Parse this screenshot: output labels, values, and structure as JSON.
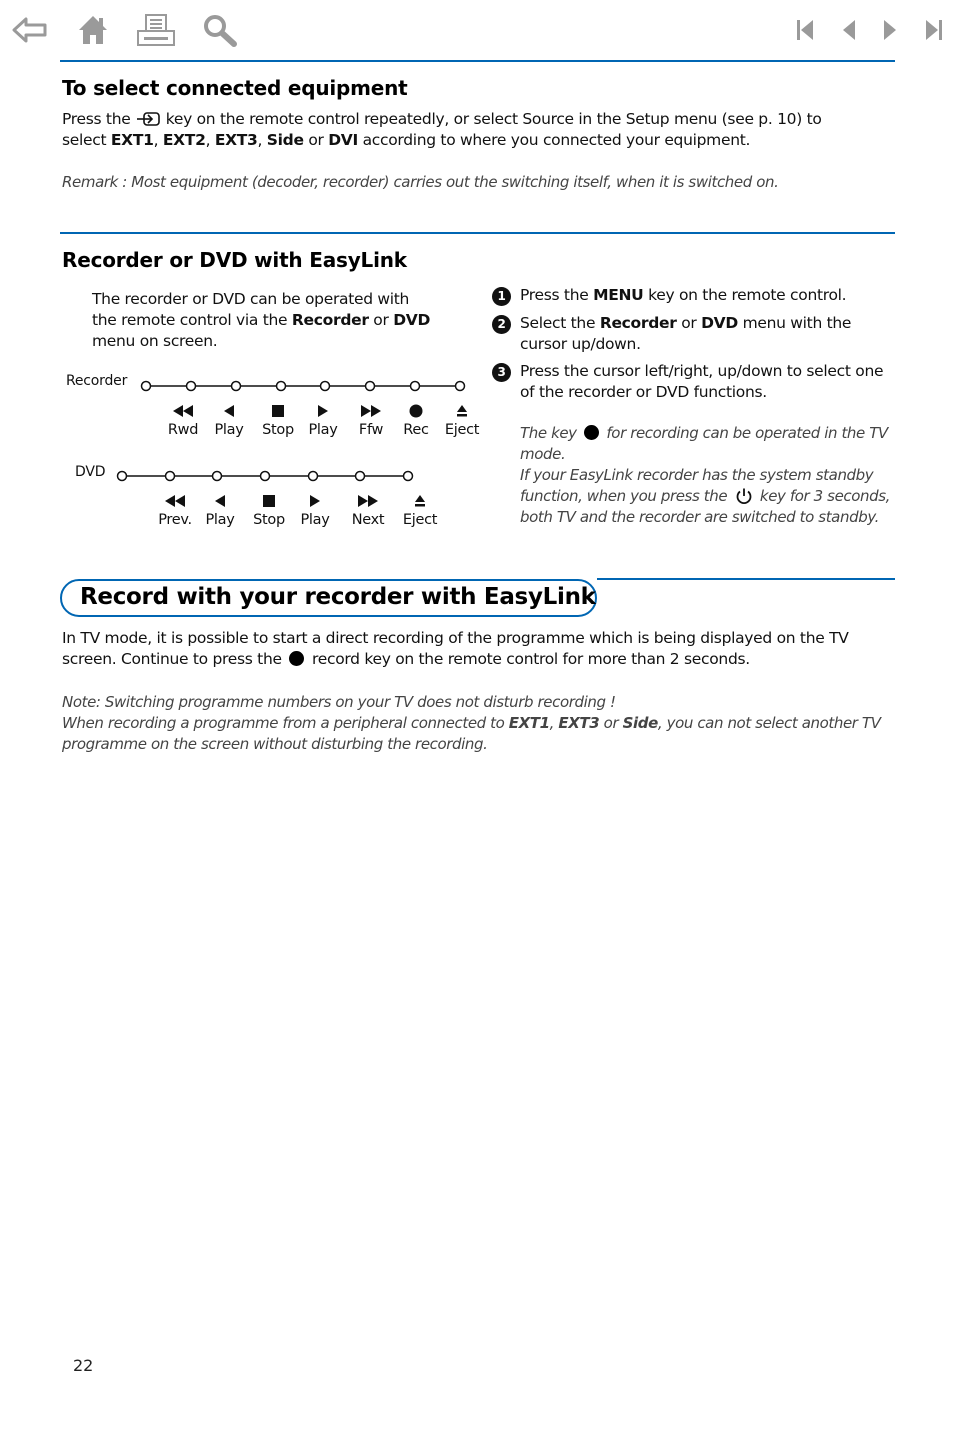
{
  "toolbar": {
    "left_icons": [
      "back-arrow-icon",
      "home-icon",
      "print-icon",
      "search-icon"
    ],
    "right_icons": [
      "first-page-icon",
      "previous-page-icon",
      "next-page-icon",
      "last-page-icon"
    ],
    "icon_color": "#9a9a9a"
  },
  "accent_color": "#0066b3",
  "section1": {
    "title": "To select connected equipment",
    "line1_a": "Press the",
    "line1_key_icon": "source-key-icon",
    "line1_b": "key on the remote control repeatedly, or select Source in the Setup menu (see p. 10) to",
    "line2_a": "select ",
    "line2_ext1": "EXT1",
    "line2_sep1": ", ",
    "line2_ext2": "EXT2",
    "line2_sep2": ", ",
    "line2_ext3": "EXT3",
    "line2_sep3": ", ",
    "line2_side": "Side",
    "line2_or": " or ",
    "line2_dvi": "DVI",
    "line2_b": " according to where you connected your equipment.",
    "remark": "Remark : Most equipment (decoder, recorder) carries out the switching itself, when it is switched on."
  },
  "section2": {
    "title": "Recorder or DVD with EasyLink",
    "intro_a": "The recorder or DVD can be operated with",
    "intro_b": "the remote control via the ",
    "intro_recorder": "Recorder",
    "intro_or": " or ",
    "intro_dvd": "DVD",
    "intro_c": "menu on screen.",
    "recorder_menu": {
      "label": "Recorder",
      "functions": [
        {
          "icon": "rewind-icon",
          "label": "Rwd"
        },
        {
          "icon": "play-reverse-icon",
          "label": "Play"
        },
        {
          "icon": "stop-icon",
          "label": "Stop"
        },
        {
          "icon": "play-icon",
          "label": "Play"
        },
        {
          "icon": "fast-forward-icon",
          "label": "Ffw"
        },
        {
          "icon": "record-icon",
          "label": "Rec"
        },
        {
          "icon": "eject-icon",
          "label": "Eject"
        }
      ]
    },
    "dvd_menu": {
      "label": "DVD",
      "functions": [
        {
          "icon": "previous-icon",
          "label": "Prev."
        },
        {
          "icon": "play-reverse-icon",
          "label": "Play"
        },
        {
          "icon": "stop-icon",
          "label": "Stop"
        },
        {
          "icon": "play-icon",
          "label": "Play"
        },
        {
          "icon": "next-icon",
          "label": "Next"
        },
        {
          "icon": "eject-icon",
          "label": "Eject"
        }
      ]
    },
    "steps": [
      {
        "num": "1",
        "a": "Press the ",
        "bold1": "MENU",
        "b": " key on the remote control."
      },
      {
        "num": "2",
        "a": "Select the ",
        "bold1": "Recorder",
        "b": " or ",
        "bold2": "DVD",
        "c": " menu with the cursor up/down."
      },
      {
        "num": "3",
        "a": "Press the cursor left/right, up/down to select one of the recorder or DVD functions."
      }
    ],
    "note1_a": "The key",
    "note1_b": "for recording can be operated in the TV mode.",
    "note2_a": "If your EasyLink recorder has the system standby function, when you press the",
    "note2_b": "key for 3 seconds, both TV and the recorder are switched to standby."
  },
  "section3": {
    "title": "Record with your recorder with EasyLink",
    "body_a": "In TV mode, it is possible to start a direct recording of the programme which is being displayed on the TV screen. Continue to press the",
    "body_b": "record key on the remote control for more than 2 seconds.",
    "note_line1": "Note: Switching programme numbers on your TV does not disturb recording !",
    "note_line2_a": "When recording a programme from a peripheral connected to ",
    "note_ext1": "EXT1",
    "note_sep": ", ",
    "note_ext3": "EXT3",
    "note_or": " or ",
    "note_side": "Side",
    "note_line2_b": ", you can not select another TV programme on the screen without disturbing the recording."
  },
  "page_number": "22"
}
